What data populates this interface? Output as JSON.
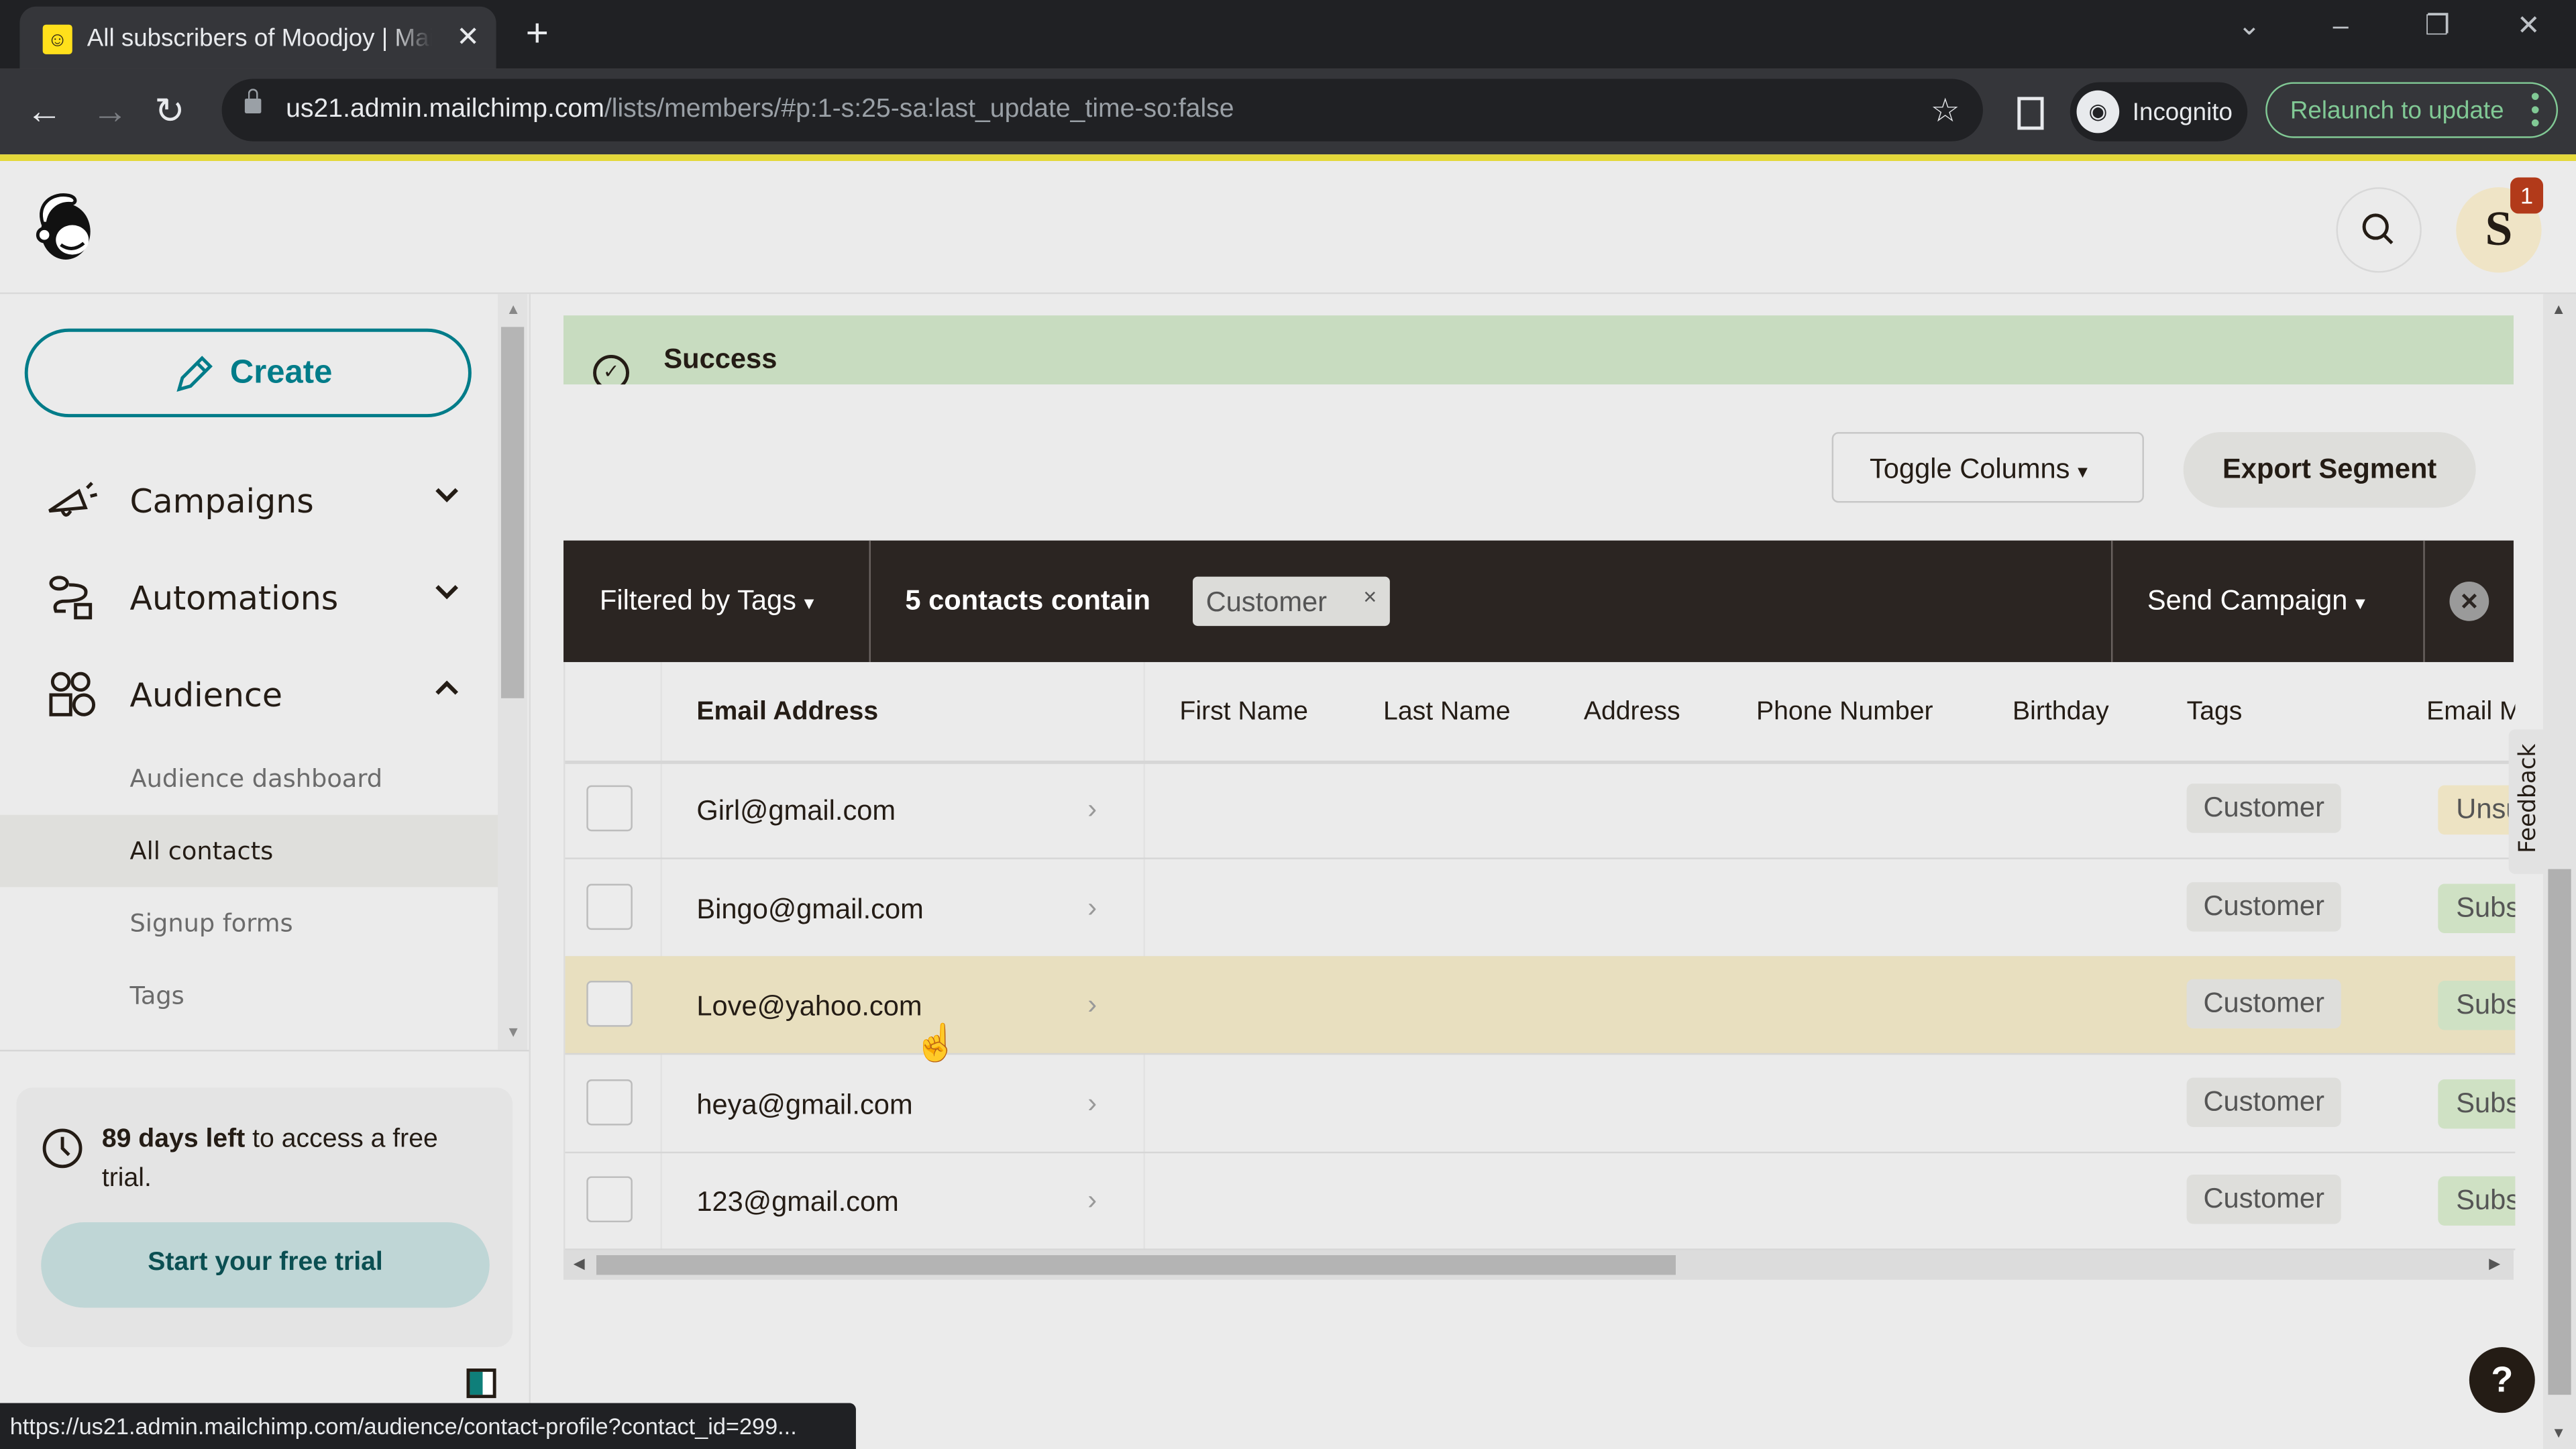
{
  "browser": {
    "tab_title": "All subscribers of Moodjoy | Mailchimp",
    "new_tab": "+",
    "url_host": "us21.admin.mailchimp.com",
    "url_path": "/lists/members/#p:1-s:25-sa:last_update_time-so:false",
    "incognito_label": "Incognito",
    "relaunch_label": "Relaunch to update",
    "status_url": "https://us21.admin.mailchimp.com/audience/contact-profile?contact_id=299..."
  },
  "header": {
    "avatar_initial": "S",
    "notification_count": "1"
  },
  "sidebar": {
    "create_label": "Create",
    "items": [
      {
        "label": "Campaigns",
        "icon": "megaphone-icon",
        "expanded": false
      },
      {
        "label": "Automations",
        "icon": "automation-flow-icon",
        "expanded": false
      },
      {
        "label": "Audience",
        "icon": "audience-icon",
        "expanded": true
      }
    ],
    "subitems": [
      {
        "label": "Audience dashboard",
        "active": false
      },
      {
        "label": "All contacts",
        "active": true
      },
      {
        "label": "Signup forms",
        "active": false
      },
      {
        "label": "Tags",
        "active": false
      }
    ],
    "trial": {
      "days_left": "89 days left",
      "rest": " to access a free trial.",
      "button_label": "Start your free trial"
    }
  },
  "main": {
    "success_label": "Success",
    "toggle_columns_label": "Toggle Columns",
    "export_label": "Export Segment",
    "filter": {
      "filter_label": "Filtered by Tags",
      "count_label": "5 contacts contain",
      "chip_label": "Customer",
      "send_campaign_label": "Send Campaign"
    },
    "table": {
      "columns": [
        "Email Address",
        "First Name",
        "Last Name",
        "Address",
        "Phone Number",
        "Birthday",
        "Tags",
        "Email M"
      ],
      "rows": [
        {
          "email": "Girl@gmail.com",
          "tag": "Customer",
          "status": "Unsu",
          "status_color": "#ede3c3"
        },
        {
          "email": "Bingo@gmail.com",
          "tag": "Customer",
          "status": "Subs",
          "status_color": "#cfe1c4"
        },
        {
          "email": "Love@yahoo.com",
          "tag": "Customer",
          "status": "Subs",
          "status_color": "#cfe1c4"
        },
        {
          "email": "heya@gmail.com",
          "tag": "Customer",
          "status": "Subs",
          "status_color": "#cfe1c4"
        },
        {
          "email": "123@gmail.com",
          "tag": "Customer",
          "status": "Subs",
          "status_color": "#cfe1c4"
        }
      ],
      "hovered_row": 2
    },
    "feedback_label": "Feedback",
    "help_label": "?"
  },
  "colors": {
    "brand_teal": "#007c89",
    "brand_yellow": "#ffe01b",
    "filter_bar": "#2b2522",
    "success_bg": "#c8dcc0",
    "hover_row": "#e8dfbf"
  }
}
